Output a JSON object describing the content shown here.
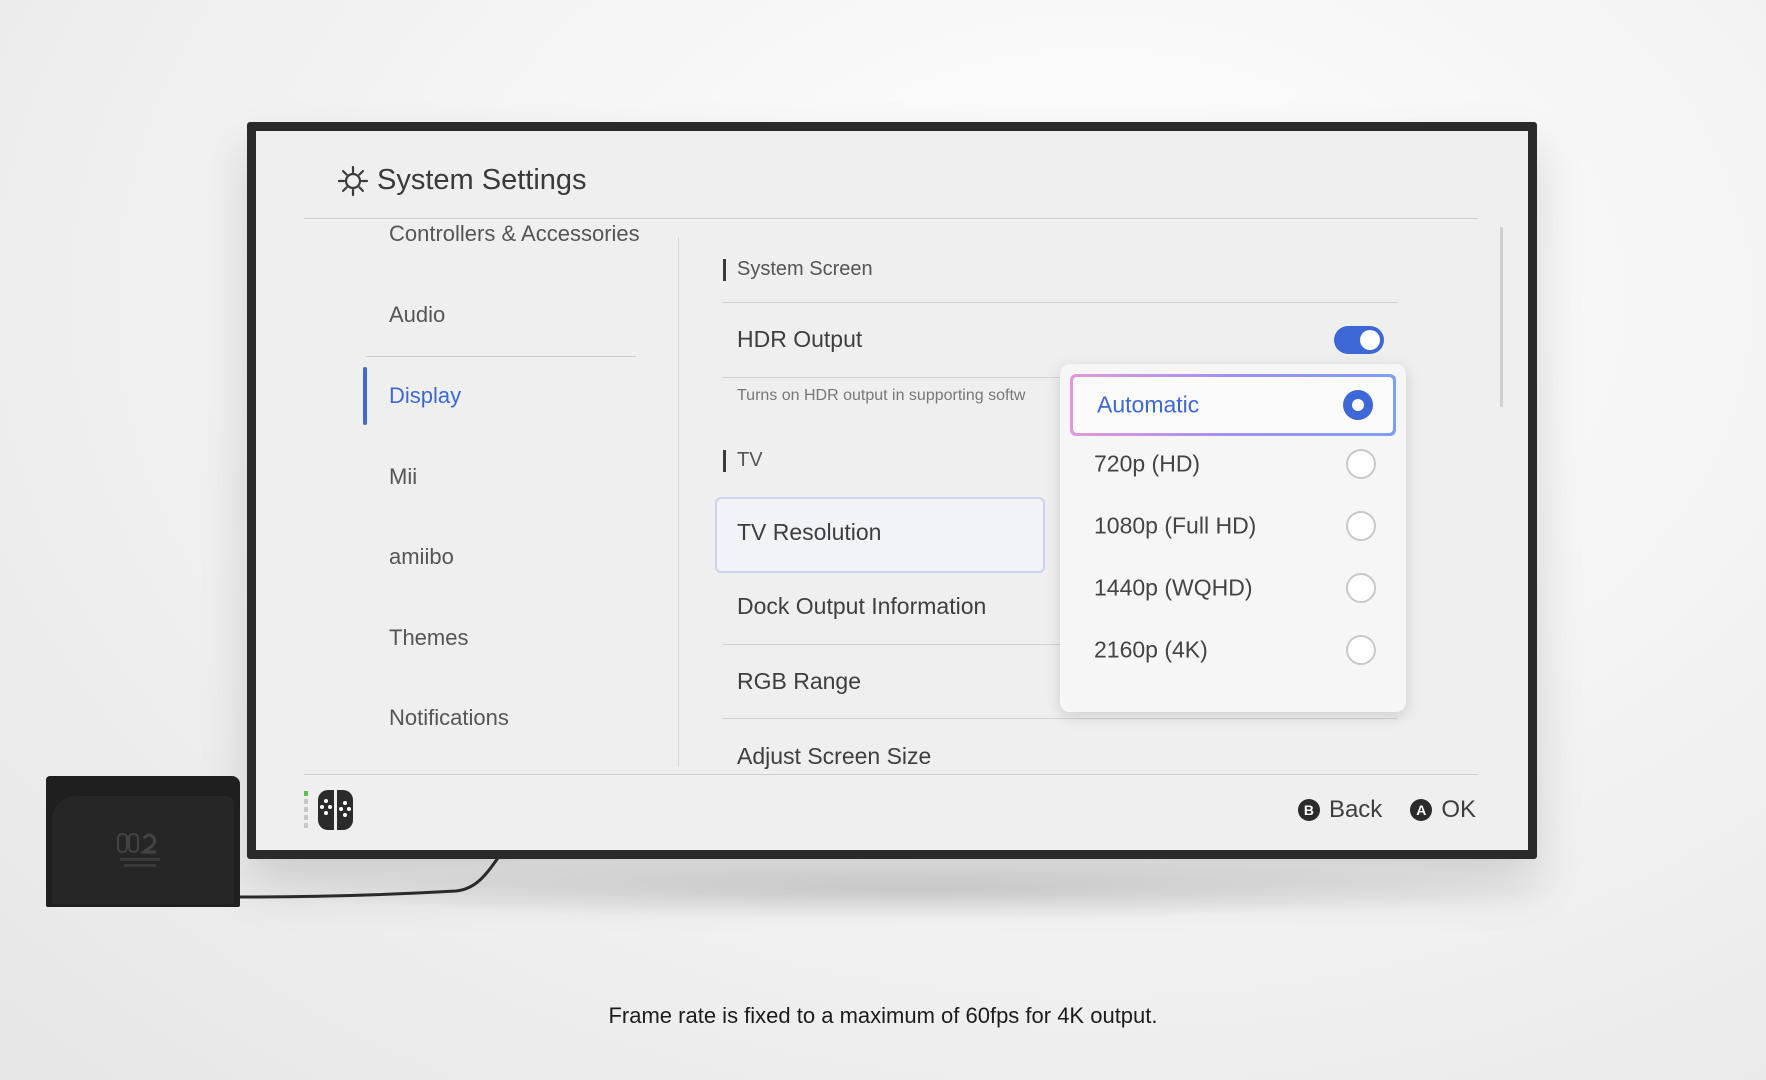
{
  "window": {
    "title": "System Settings"
  },
  "sidebar": {
    "items": [
      {
        "label": "Controllers & Accessories",
        "active": false
      },
      {
        "label": "Audio",
        "active": false
      },
      {
        "label": "Display",
        "active": true
      },
      {
        "label": "Mii",
        "active": false
      },
      {
        "label": "amiibo",
        "active": false
      },
      {
        "label": "Themes",
        "active": false
      },
      {
        "label": "Notifications",
        "active": false
      }
    ]
  },
  "main": {
    "sections": [
      {
        "heading": "System Screen"
      },
      {
        "heading": "TV"
      }
    ],
    "rows": {
      "hdr_output": {
        "label": "HDR Output",
        "enabled": true,
        "hint": "Turns on HDR output in supporting softw"
      },
      "tv_resolution": {
        "label": "TV Resolution"
      },
      "dock_output": {
        "label": "Dock Output Information"
      },
      "rgb_range": {
        "label": "RGB Range"
      },
      "adjust_screen": {
        "label": "Adjust Screen Size"
      }
    }
  },
  "resolution_dropdown": {
    "selected": "Automatic",
    "options": [
      {
        "label": "Automatic",
        "selected": true
      },
      {
        "label": "720p (HD)",
        "selected": false
      },
      {
        "label": "1080p (Full HD)",
        "selected": false
      },
      {
        "label": "1440p (WQHD)",
        "selected": false
      },
      {
        "label": "2160p (4K)",
        "selected": false
      }
    ]
  },
  "footer": {
    "back": {
      "glyph": "B",
      "label": "Back"
    },
    "ok": {
      "glyph": "A",
      "label": "OK"
    }
  },
  "caption": "Frame rate is fixed to a maximum of 60fps for 4K output.",
  "colors": {
    "accent": "#3d68d6",
    "background": "#efefef",
    "tv_bezel": "#2a2a2a"
  },
  "icons": [
    "gear-icon",
    "joycon-icon",
    "b-button-icon",
    "a-button-icon",
    "switch2-logo-icon"
  ]
}
